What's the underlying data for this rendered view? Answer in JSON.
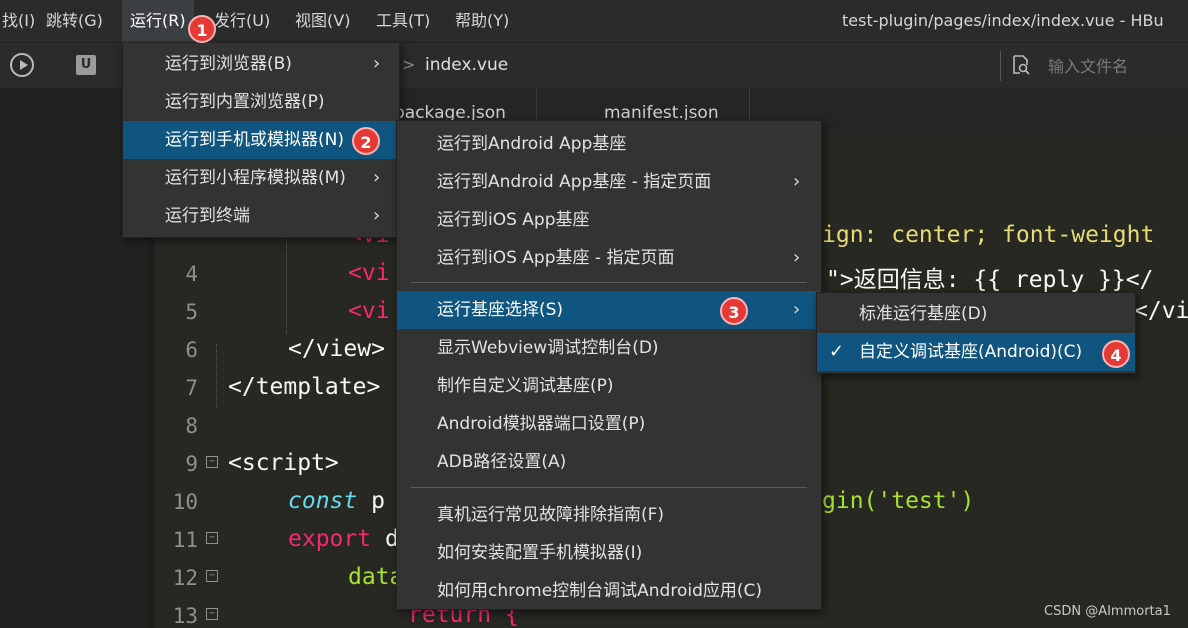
{
  "menubar": {
    "items": [
      "找(I)",
      "跳转(G)",
      "运行(R)",
      "发行(U)",
      "视图(V)",
      "工具(T)",
      "帮助(Y)"
    ],
    "window_title": "test-plugin/pages/index/index.vue - HBu"
  },
  "toolbar": {
    "u_icon": "U",
    "breadcrumb_sep": ">",
    "current_file": "index.vue",
    "search_placeholder": "输入文件名"
  },
  "tabs": [
    "package.json",
    "manifest.json"
  ],
  "editor": {
    "line_numbers": [
      "4",
      "5",
      "6",
      "7",
      "8",
      "9",
      "10",
      "11",
      "12",
      "13"
    ],
    "code": {
      "l3_tail": "ign: center; font-weight",
      "l3_start": "<vi",
      "l4_start": "<vi",
      "l4_tail": "\">返回信息: {{ reply }}</",
      "l5_start": "<vi",
      "l5_tail": "</vi",
      "l6": "</view>",
      "l7": "</template>",
      "l9": "<script>",
      "l10_kw": "const",
      "l10_mid": " p",
      "l10_tail": "gin('test')",
      "l11_kw": "export",
      "l11_tail": " d",
      "l12": "data",
      "l13": "return {"
    }
  },
  "run_menu": {
    "items": [
      {
        "label": "运行到浏览器(B)",
        "submenu": true
      },
      {
        "label": "运行到内置浏览器(P)",
        "submenu": false
      },
      {
        "label": "运行到手机或模拟器(N)",
        "submenu": true,
        "highlighted": true
      },
      {
        "label": "运行到小程序模拟器(M)",
        "submenu": true
      },
      {
        "label": "运行到终端",
        "submenu": true
      }
    ]
  },
  "device_menu": {
    "items": [
      {
        "label": "运行到Android App基座",
        "submenu": false
      },
      {
        "label": "运行到Android App基座 - 指定页面",
        "submenu": true
      },
      {
        "label": "运行到iOS App基座",
        "submenu": false
      },
      {
        "label": "运行到iOS App基座 - 指定页面",
        "submenu": true
      },
      {
        "label": "运行基座选择(S)",
        "submenu": true,
        "highlighted": true
      },
      {
        "label": "显示Webview调试控制台(D)",
        "submenu": false
      },
      {
        "label": "制作自定义调试基座(P)",
        "submenu": false
      },
      {
        "label": "Android模拟器端口设置(P)",
        "submenu": false
      },
      {
        "label": "ADB路径设置(A)",
        "submenu": false
      },
      {
        "label": "真机运行常见故障排除指南(F)",
        "submenu": false
      },
      {
        "label": "如何安装配置手机模拟器(I)",
        "submenu": false
      },
      {
        "label": "如何用chrome控制台调试Android应用(C)",
        "submenu": false
      }
    ]
  },
  "base_menu": {
    "items": [
      {
        "label": "标准运行基座(D)",
        "checked": false
      },
      {
        "label": "自定义调试基座(Android)(C)",
        "checked": true,
        "highlighted": true
      }
    ],
    "check_glyph": "✓"
  },
  "arrow_glyph": "›",
  "badges": [
    "1",
    "2",
    "3",
    "4"
  ],
  "watermark": "CSDN @AImmorta1",
  "colors": {
    "menu_bg": "#333333",
    "highlight": "#10557f",
    "badge": "#e53935",
    "editor_bg": "#272822",
    "tag": "#f92672",
    "string": "#e6db74"
  }
}
